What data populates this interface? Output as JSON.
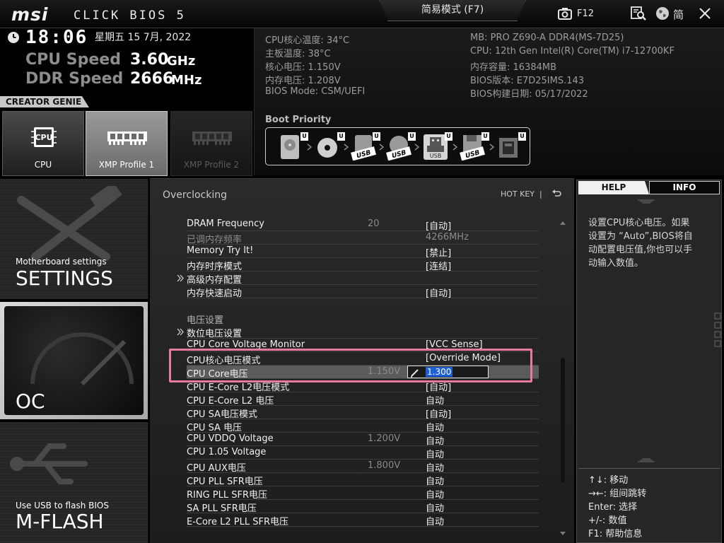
{
  "header": {
    "brand": "msi",
    "product": "CLICK BIOS 5",
    "mode_label": "简易模式 (F7)",
    "screenshot_key": "F12",
    "language_label": "简"
  },
  "status": {
    "time": "18:06",
    "date": "星期五 15 7月, 2022",
    "cpu_speed_label": "CPU Speed",
    "cpu_speed_value": "3.60",
    "cpu_speed_unit": "GHz",
    "ddr_speed_label": "DDR Speed",
    "ddr_speed_value": "2666",
    "ddr_speed_unit": "MHz"
  },
  "sysinfo": {
    "left": [
      "CPU核心温度: 34°C",
      "主板温度: 38°C",
      "核心电压: 1.150V",
      "内存电压: 1.208V",
      "BIOS Mode: CSM/UEFI"
    ],
    "right": [
      "MB: PRO Z690-A DDR4(MS-7D25)",
      "CPU: 12th Gen Intel(R) Core(TM) i7-12700KF",
      "内存容量: 16384MB",
      "BIOS版本: E7D25IMS.143",
      "BIOS构建日期: 05/17/2022"
    ]
  },
  "boot": {
    "title": "Boot Priority",
    "badge": "U",
    "usb_label": "USB",
    "devices": [
      "hdd",
      "optical",
      "usb-disk",
      "usb-optical",
      "usb-drive",
      "usb-floppy",
      "network"
    ]
  },
  "creator_genie": {
    "title": "CREATOR GENIE",
    "cards": [
      "CPU",
      "XMP Profile 1",
      "XMP Profile 2"
    ],
    "active": "XMP Profile 1"
  },
  "nav": {
    "settings_sub": "Motherboard settings",
    "settings_title": "SETTINGS",
    "oc_title": "OC",
    "mflash_sub": "Use USB to flash BIOS",
    "mflash_title": "M-FLASH"
  },
  "main": {
    "section_title": "Overclocking",
    "hotkey_label": "HOT KEY",
    "hotkey_sep": "|",
    "rows": [
      {
        "name": "DRAM Frequency",
        "cur": "20",
        "val": "[自动]"
      },
      {
        "name": "已调内存频率",
        "cur": "",
        "val": "4266MHz",
        "dim": true
      },
      {
        "name": "Memory Try It!",
        "cur": "",
        "val": "[禁止]"
      },
      {
        "name": "内存时序模式",
        "cur": "",
        "val": "[连结]"
      },
      {
        "name": "高级内存配置",
        "cur": "",
        "val": "",
        "submenu": true
      },
      {
        "name": "内存快速启动",
        "cur": "",
        "val": "[自动]"
      },
      {
        "name": "",
        "cur": "",
        "val": "",
        "spacer": true
      },
      {
        "name": "电压设置",
        "cur": "",
        "val": "",
        "section": true
      },
      {
        "name": "数位电压设置",
        "cur": "",
        "val": "",
        "submenu": true
      },
      {
        "name": "CPU Core Voltage Monitor",
        "cur": "",
        "val": "[VCC Sense]"
      },
      {
        "name": "CPU核心电压模式",
        "cur": "",
        "val": "[Override Mode]"
      },
      {
        "name": "CPU Core电压",
        "cur": "1.150V",
        "val": "",
        "selected": true
      },
      {
        "name": "CPU E-Core L2电压模式",
        "cur": "",
        "val": "[自动]"
      },
      {
        "name": "CPU E-Core L2 电压",
        "cur": "",
        "val": "自动"
      },
      {
        "name": "CPU SA电压模式",
        "cur": "",
        "val": "[自动]"
      },
      {
        "name": "CPU SA 电压",
        "cur": "",
        "val": "自动"
      },
      {
        "name": "CPU VDDQ Voltage",
        "cur": "1.200V",
        "val": "自动"
      },
      {
        "name": "CPU 1.05 Voltage",
        "cur": "",
        "val": "自动"
      },
      {
        "name": "CPU AUX电压",
        "cur": "1.800V",
        "val": "自动"
      },
      {
        "name": "CPU PLL SFR电压",
        "cur": "",
        "val": "自动"
      },
      {
        "name": "RING PLL SFR电压",
        "cur": "",
        "val": "自动"
      },
      {
        "name": "SA PLL SFR电压",
        "cur": "",
        "val": "自动"
      },
      {
        "name": "E-Core L2 PLL SFR电压",
        "cur": "",
        "val": "自动"
      }
    ],
    "edit_value": "1.300"
  },
  "help": {
    "tab_help": "HELP",
    "tab_info": "INFO",
    "text": "设置CPU核心电压。如果设置为 “Auto”,BIOS将自动配置电压值,你也可以手动输入数值。",
    "keys": [
      "↑↓: 移动",
      "→←: 组间跳转",
      "Enter: 选择",
      "+/-: 数值",
      "F1: 帮助信息"
    ]
  },
  "colors": {
    "highlight": "#e879a0",
    "edit_selection": "#1d5fd6",
    "selected_row": "#5b5b5b"
  }
}
